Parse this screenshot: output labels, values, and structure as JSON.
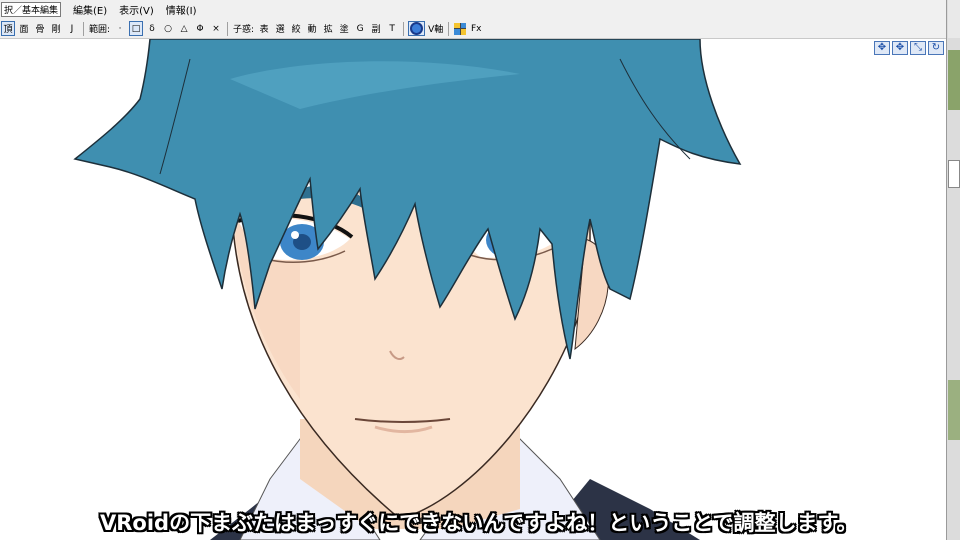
{
  "menubar": {
    "mode_select": "択／基本編集",
    "items": [
      "編集(E)",
      "表示(V)",
      "情報(I)"
    ]
  },
  "toolbar": {
    "view_buttons": [
      "頂",
      "面",
      "骨",
      "剛",
      "J"
    ],
    "range_label": "範囲:",
    "range_buttons": [
      "·",
      "□",
      "δ",
      "○",
      "△",
      "Φ",
      "×"
    ],
    "child_label": "子惑:",
    "child_buttons": [
      "表",
      "選",
      "絞",
      "動",
      "拡",
      "塗",
      "G",
      "副",
      "T"
    ],
    "vaxis_label": "V軸",
    "fx_label": "Fx"
  },
  "view_controls": [
    "✥",
    "✥",
    "⤡",
    "↻"
  ],
  "subtitle": "VRoidの下まぶたはまっすぐにできないんですよね！ということで調整します。",
  "colors": {
    "hair": "#3f8fb0",
    "skin": "#fbe3cf",
    "eye": "#3d86c8",
    "ui_bg": "#f0f0f0",
    "accent": "#3a6fb0"
  }
}
